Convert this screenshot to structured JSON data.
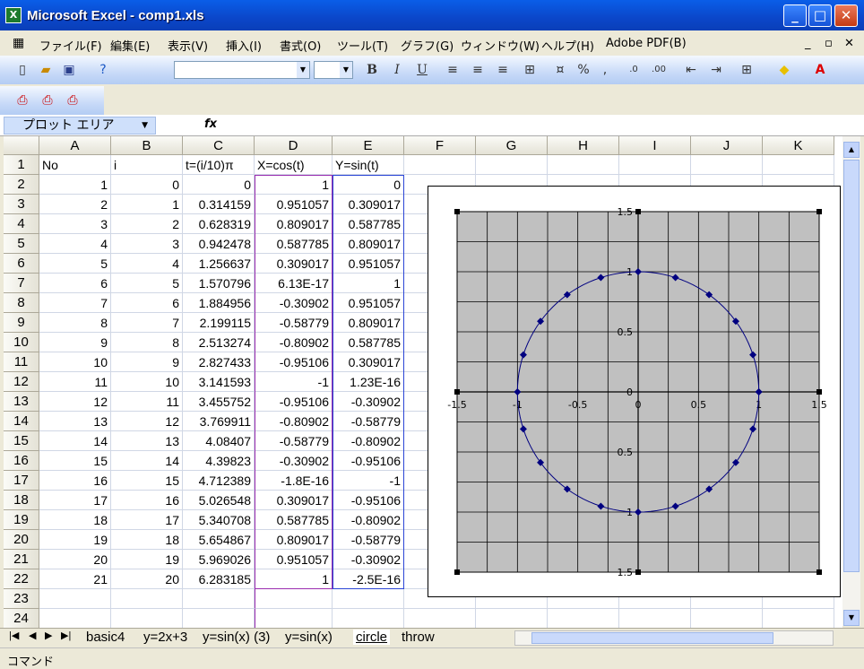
{
  "window": {
    "title": "Microsoft Excel - comp1.xls",
    "app_icon": "X"
  },
  "menu": [
    "ファイル(F)",
    "編集(E)",
    "表示(V)",
    "挿入(I)",
    "書式(O)",
    "ツール(T)",
    "グラフ(G)",
    "ウィンドウ(W)",
    "ヘルプ(H)",
    "Adobe PDF(B)"
  ],
  "formula": {
    "namebox": "プロット エリア",
    "fx": "fx"
  },
  "columns": [
    "A",
    "B",
    "C",
    "D",
    "E",
    "F",
    "G",
    "H",
    "I",
    "J",
    "K"
  ],
  "rows": [
    [
      "No",
      "i",
      "t=(i/10)π",
      "X=cos(t)",
      "Y=sin(t)"
    ],
    [
      "1",
      "0",
      "0",
      "1",
      "0"
    ],
    [
      "2",
      "1",
      "0.314159",
      "0.951057",
      "0.309017"
    ],
    [
      "3",
      "2",
      "0.628319",
      "0.809017",
      "0.587785"
    ],
    [
      "4",
      "3",
      "0.942478",
      "0.587785",
      "0.809017"
    ],
    [
      "5",
      "4",
      "1.256637",
      "0.309017",
      "0.951057"
    ],
    [
      "6",
      "5",
      "1.570796",
      "6.13E-17",
      "1"
    ],
    [
      "7",
      "6",
      "1.884956",
      "-0.30902",
      "0.951057"
    ],
    [
      "8",
      "7",
      "2.199115",
      "-0.58779",
      "0.809017"
    ],
    [
      "9",
      "8",
      "2.513274",
      "-0.80902",
      "0.587785"
    ],
    [
      "10",
      "9",
      "2.827433",
      "-0.95106",
      "0.309017"
    ],
    [
      "11",
      "10",
      "3.141593",
      "-1",
      "1.23E-16"
    ],
    [
      "12",
      "11",
      "3.455752",
      "-0.95106",
      "-0.30902"
    ],
    [
      "13",
      "12",
      "3.769911",
      "-0.80902",
      "-0.58779"
    ],
    [
      "14",
      "13",
      "4.08407",
      "-0.58779",
      "-0.80902"
    ],
    [
      "15",
      "14",
      "4.39823",
      "-0.30902",
      "-0.95106"
    ],
    [
      "16",
      "15",
      "4.712389",
      "-1.8E-16",
      "-1"
    ],
    [
      "17",
      "16",
      "5.026548",
      "0.309017",
      "-0.95106"
    ],
    [
      "18",
      "17",
      "5.340708",
      "0.587785",
      "-0.80902"
    ],
    [
      "19",
      "18",
      "5.654867",
      "0.809017",
      "-0.58779"
    ],
    [
      "20",
      "19",
      "5.969026",
      "0.951057",
      "-0.30902"
    ],
    [
      "21",
      "20",
      "6.283185",
      "1",
      "-2.5E-16"
    ],
    [
      "",
      "",
      "",
      "",
      ""
    ],
    [
      "",
      "",
      "",
      "",
      ""
    ]
  ],
  "sheet_tabs": [
    "basic4",
    "y=2x+3",
    "y=sin(x) (3)",
    "y=sin(x)",
    "circle",
    "throw"
  ],
  "active_tab": "circle",
  "status": "コマンド",
  "chart_data": {
    "type": "scatter",
    "x": [
      1,
      0.951057,
      0.809017,
      0.587785,
      0.309017,
      0,
      -0.30902,
      -0.58779,
      -0.80902,
      -0.95106,
      -1,
      -0.95106,
      -0.80902,
      -0.58779,
      -0.30902,
      0,
      0.309017,
      0.587785,
      0.809017,
      0.951057,
      1
    ],
    "y": [
      0,
      0.309017,
      0.587785,
      0.809017,
      0.951057,
      1,
      0.951057,
      0.809017,
      0.587785,
      0.309017,
      0,
      -0.30902,
      -0.58779,
      -0.80902,
      -0.95106,
      -1,
      -0.95106,
      -0.80902,
      -0.58779,
      -0.30902,
      0
    ],
    "xlim": [
      -1.5,
      1.5
    ],
    "ylim": [
      -1.5,
      1.5
    ],
    "x_ticks": [
      "-1.5",
      "-1",
      "-0.5",
      "0",
      "0.5",
      "1",
      "1.5"
    ],
    "y_ticks": [
      "1.5",
      "1",
      "0.5",
      "0",
      "0.5",
      "1",
      "1.5"
    ],
    "grid": true,
    "plot_bg": "#c0c0c0",
    "series_color": "#000080"
  }
}
